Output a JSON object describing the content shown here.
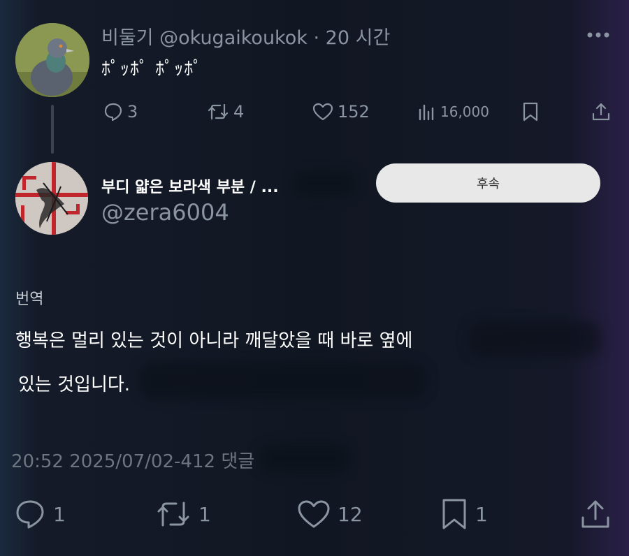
{
  "main_tweet": {
    "display_name": "비둘기",
    "handle": "@okugaikoukok",
    "separator": "·",
    "time_ago": "20 시간",
    "text": "ﾎﾟｯﾎﾟ ﾎﾟｯﾎﾟ",
    "actions": {
      "replies": "3",
      "retweets": "4",
      "likes": "152",
      "views": "16,000"
    }
  },
  "quoted_user": {
    "display_name": "부디 얇은 보라색 부분 / ...",
    "handle": "@zera6004",
    "follow_label": "후속"
  },
  "translation": {
    "label": "번역",
    "line1": "행복은 멀리 있는 것이 아니라 깨달았을 때 바로 옆에",
    "line2": "있는 것입니다."
  },
  "timestamp": "20:52 2025/07/02-412 댓글",
  "bottom_actions": {
    "replies": "1",
    "retweets": "1",
    "likes": "12",
    "bookmarks": "1"
  },
  "colors": {
    "background": "#111722",
    "muted_text": "#8b95a1",
    "button_bg": "#e8e8e8"
  }
}
